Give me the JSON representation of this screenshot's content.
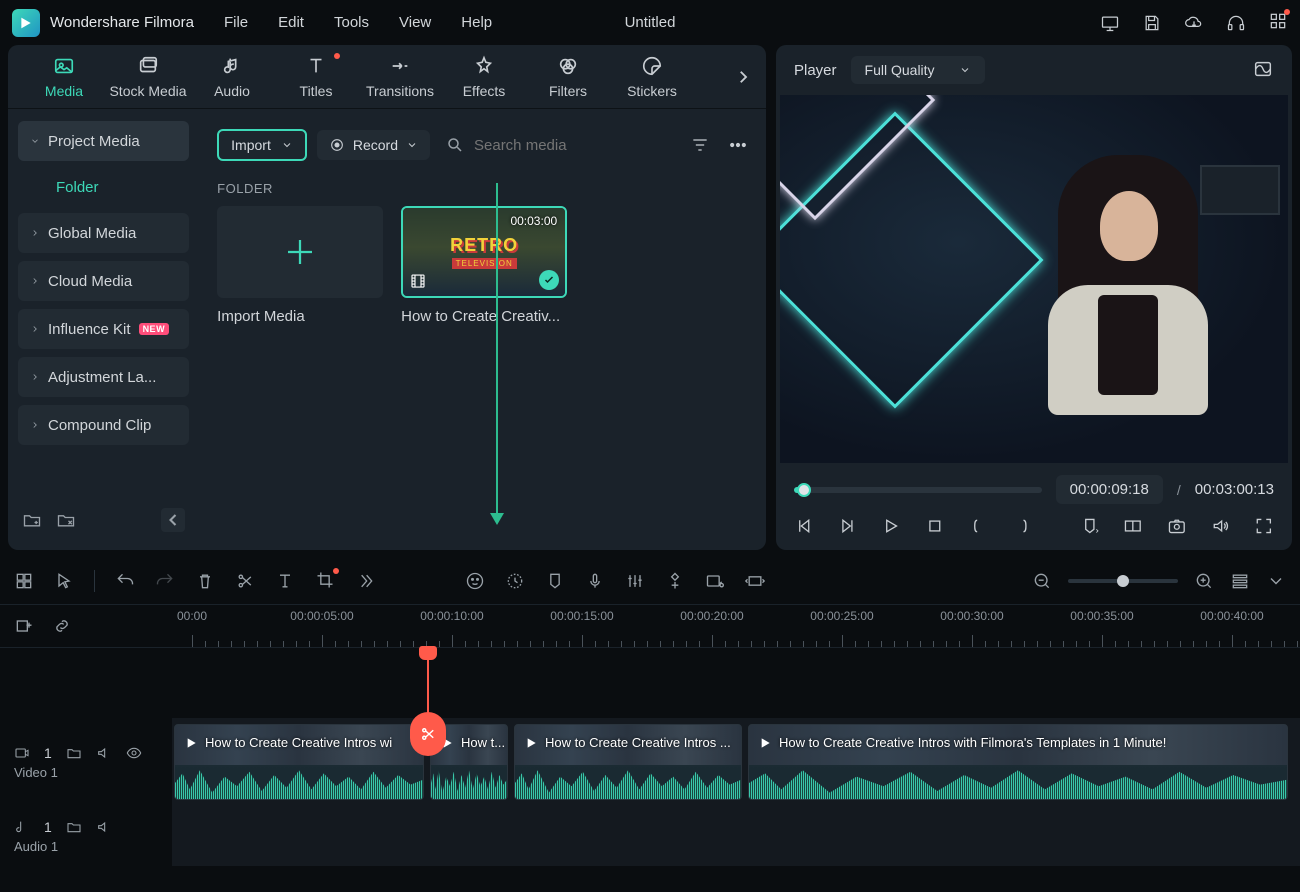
{
  "app": {
    "name": "Wondershare Filmora",
    "project_title": "Untitled"
  },
  "menu": [
    "File",
    "Edit",
    "Tools",
    "View",
    "Help"
  ],
  "asset_tabs": [
    {
      "id": "media",
      "label": "Media",
      "active": true
    },
    {
      "id": "stock",
      "label": "Stock Media"
    },
    {
      "id": "audio",
      "label": "Audio"
    },
    {
      "id": "titles",
      "label": "Titles",
      "dot": true
    },
    {
      "id": "transitions",
      "label": "Transitions"
    },
    {
      "id": "effects",
      "label": "Effects"
    },
    {
      "id": "filters",
      "label": "Filters"
    },
    {
      "id": "stickers",
      "label": "Stickers"
    }
  ],
  "media_sidebar": {
    "project": "Project Media",
    "folder": "Folder",
    "items": [
      {
        "label": "Global Media"
      },
      {
        "label": "Cloud Media"
      },
      {
        "label": "Influence Kit",
        "badge": "NEW"
      },
      {
        "label": "Adjustment La..."
      },
      {
        "label": "Compound Clip"
      }
    ]
  },
  "media_toolbar": {
    "import": "Import",
    "record": "Record",
    "search_placeholder": "Search media"
  },
  "media_main": {
    "folder_label": "FOLDER",
    "import_card": "Import Media",
    "clip": {
      "duration": "00:03:00",
      "title": "How to Create Creativ...",
      "retro1": "RETRO",
      "retro2": "TELEVISION"
    }
  },
  "player": {
    "label": "Player",
    "quality": "Full Quality",
    "current": "00:00:09:18",
    "total": "00:03:00:13",
    "sep": "/"
  },
  "timeline": {
    "ruler": [
      "00:00",
      "00:00:05:00",
      "00:00:10:00",
      "00:00:15:00",
      "00:00:20:00",
      "00:00:25:00",
      "00:00:30:00",
      "00:00:35:00",
      "00:00:40:00"
    ],
    "video_track_num": "1",
    "video_track_label": "Video 1",
    "audio_track_num": "1",
    "audio_track_label": "Audio 1",
    "clips": [
      {
        "label": "How to Create Creative Intros wi"
      },
      {
        "label": "How t..."
      },
      {
        "label": "How to Create Creative Intros ..."
      },
      {
        "label": "How to Create Creative Intros with Filmora's Templates in 1 Minute!"
      }
    ]
  }
}
